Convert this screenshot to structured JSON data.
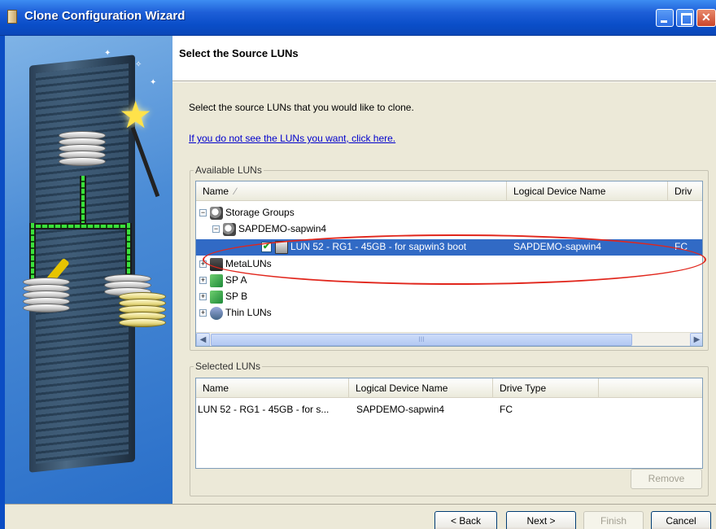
{
  "window": {
    "title": "Clone Configuration Wizard"
  },
  "page": {
    "title": "Select the Source LUNs",
    "instruction": "Select the source LUNs that you would like to clone.",
    "help_link": "If you do not see the LUNs you want, click here."
  },
  "available": {
    "legend": "Available LUNs",
    "columns": [
      "Name",
      "Logical Device Name",
      "Driv"
    ],
    "sort_indicator": "∕",
    "tree": {
      "storage_groups": "Storage Groups",
      "group": "SAPDEMO-sapwin4",
      "selected_lun": {
        "name": "LUN 52 - RG1 - 45GB - for sapwin3 boot",
        "device": "SAPDEMO-sapwin4",
        "drive": "FC"
      },
      "metaluns": "MetaLUNs",
      "spa": "SP A",
      "spb": "SP B",
      "thin": "Thin LUNs"
    },
    "scroll_grip": "III"
  },
  "selected": {
    "legend": "Selected LUNs",
    "columns": [
      "Name",
      "Logical Device Name",
      "Drive Type"
    ],
    "rows": [
      {
        "name": "LUN 52 - RG1 - 45GB - for s...",
        "device": "SAPDEMO-sapwin4",
        "drive": "FC"
      }
    ],
    "remove_label": "Remove"
  },
  "footer": {
    "back": "< Back",
    "next": "Next >",
    "finish": "Finish",
    "cancel": "Cancel"
  },
  "colors": {
    "titlebar": "#0a4ec9",
    "selection": "#316ac5",
    "annotation": "#e1261c",
    "link": "#0000cc"
  }
}
